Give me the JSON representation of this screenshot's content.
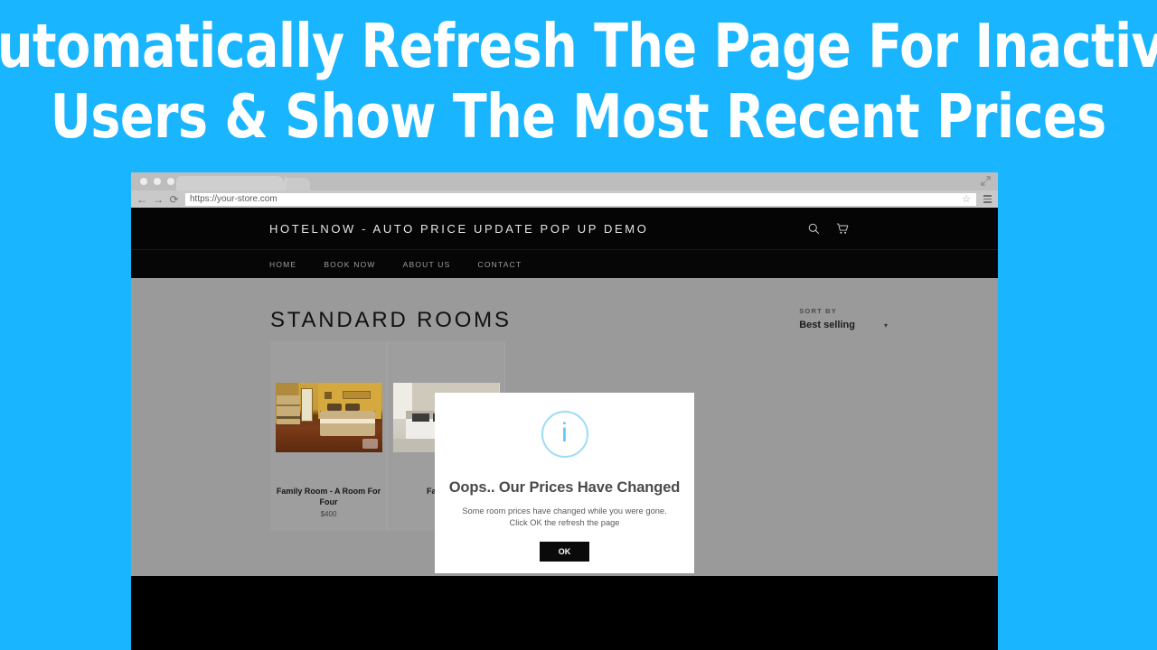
{
  "banner": {
    "line1": "Automatically Refresh The Page For Inactive",
    "line2": "Users & Show The Most Recent Prices",
    "background_color": "#19b5fe",
    "text_color": "#ffffff"
  },
  "browser": {
    "url": "https://your-store.com",
    "back_icon": "←",
    "forward_icon": "→",
    "reload_icon": "⟳",
    "star_icon": "☆",
    "menu_icon": "hamburger-menu-icon",
    "expand_icon": "⤢"
  },
  "site": {
    "store_title": "HOTELNOW - AUTO PRICE UPDATE POP UP DEMO",
    "search_icon": "search-icon",
    "cart_icon": "cart-icon",
    "nav": [
      {
        "label": "HOME"
      },
      {
        "label": "BOOK NOW"
      },
      {
        "label": "ABOUT US"
      },
      {
        "label": "CONTACT"
      }
    ],
    "page_title": "STANDARD ROOMS",
    "sort": {
      "label": "SORT BY",
      "value": "Best selling",
      "caret": "▾"
    },
    "products": [
      {
        "title": "Family Room - A Room For Four",
        "price": "$400",
        "image": "warm-yellow-bedroom-with-bunk-bed"
      },
      {
        "title": "Family Ro",
        "price": "$",
        "image": "grey-white-bedroom"
      }
    ]
  },
  "modal": {
    "icon": "info-icon",
    "icon_glyph": "i",
    "icon_color": "#5ec8f0",
    "title": "Oops.. Our Prices Have Changed",
    "line1": "Some room prices have changed while you were gone.",
    "line2": "Click OK the refresh the page",
    "ok_label": "OK",
    "ok_background": "#0a0a0a"
  }
}
